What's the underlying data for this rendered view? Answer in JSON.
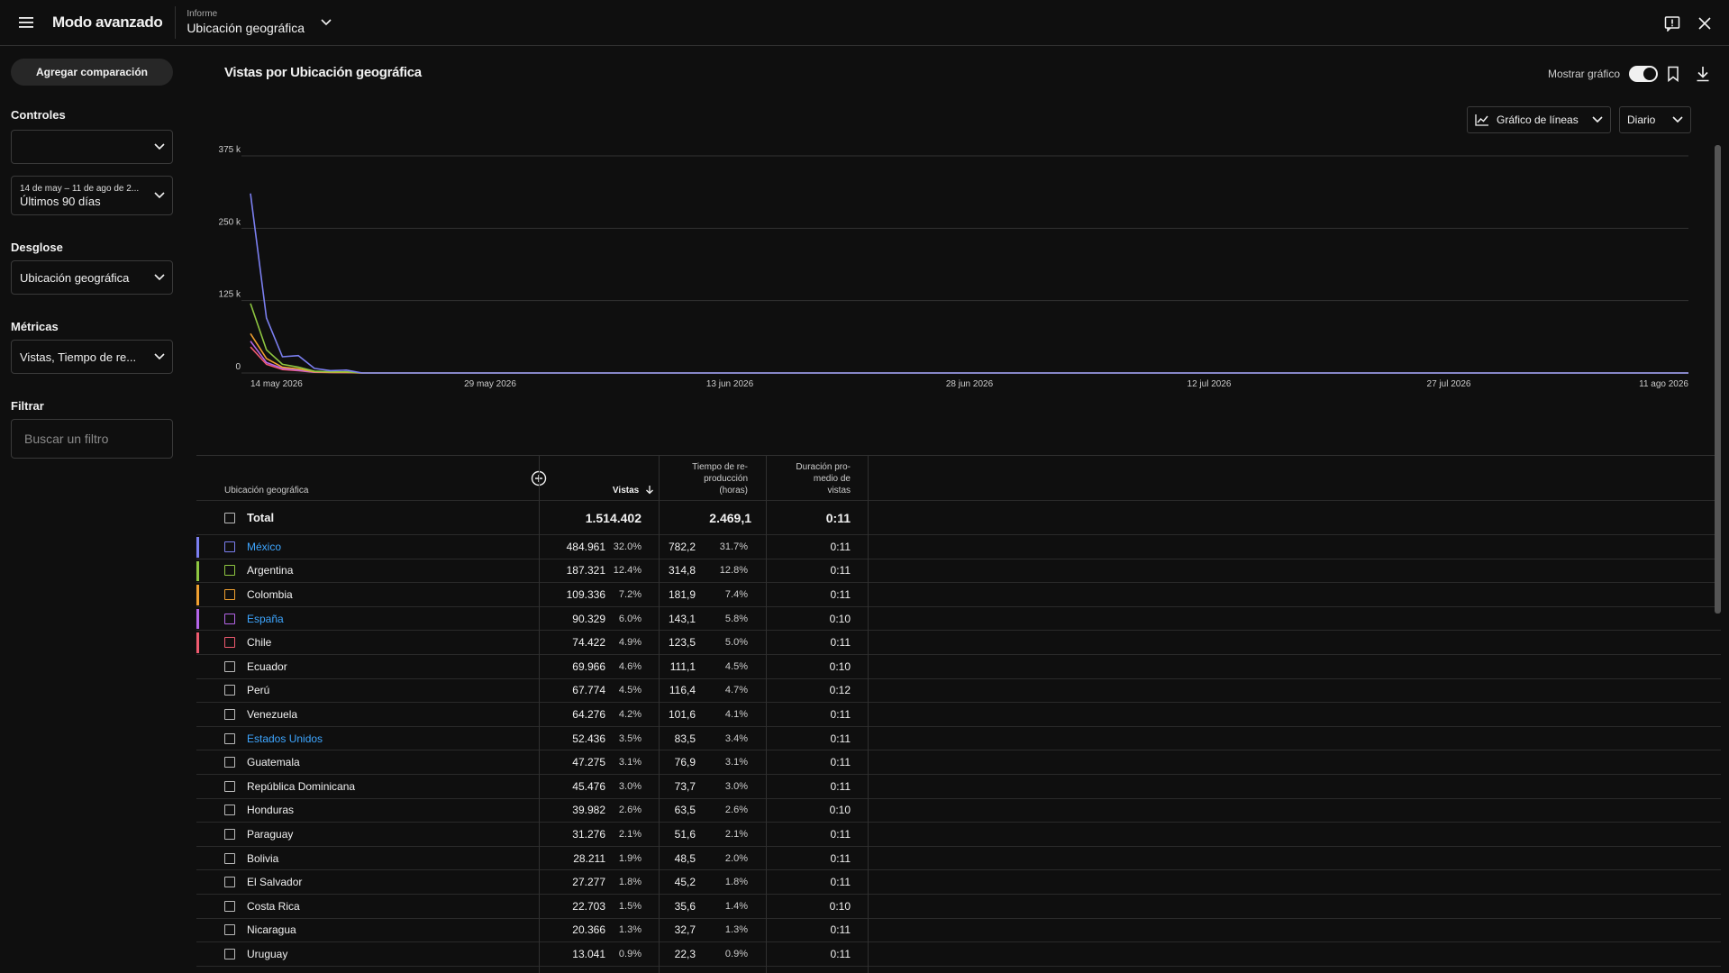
{
  "header": {
    "app_title": "Modo avanzado",
    "report_label": "Informe",
    "report_value": "Ubicación geográfica"
  },
  "sidebar": {
    "add_comparison": "Agregar comparación",
    "controls_label": "Controles",
    "controls_value": "",
    "date_range_sub": "14 de may – 11 de ago de 2...",
    "date_range_value": "Últimos 90 días",
    "breakdown_label": "Desglose",
    "breakdown_value": "Ubicación geográfica",
    "metrics_label": "Métricas",
    "metrics_value": "Vistas, Tiempo de re...",
    "filter_label": "Filtrar",
    "filter_placeholder": "Buscar un filtro"
  },
  "main": {
    "chart_title": "Vistas por Ubicación geográfica",
    "show_chart_label": "Mostrar gráfico",
    "chart_type": "Gráfico de líneas",
    "granularity": "Diario"
  },
  "chart_data": {
    "type": "line",
    "x_labels": [
      "14 may 2026",
      "29 may 2026",
      "13 jun 2026",
      "28 jun 2026",
      "12 jul 2026",
      "27 jul 2026",
      "11 ago 2026"
    ],
    "y_ticks": [
      "0",
      "125 k",
      "250 k",
      "375 k"
    ],
    "ylim": [
      0,
      375000
    ],
    "x_days": 90,
    "series": [
      {
        "name": "México",
        "color": "#7b7ff0",
        "values": [
          310000,
          95000,
          28000,
          30000,
          8000,
          4000,
          5000,
          0
        ]
      },
      {
        "name": "Argentina",
        "color": "#8ec641",
        "values": [
          120000,
          40000,
          15000,
          10000,
          3000,
          2000,
          2000,
          0
        ]
      },
      {
        "name": "Colombia",
        "color": "#f0a030",
        "values": [
          68000,
          25000,
          10000,
          7000,
          2000,
          1000,
          1000,
          0
        ]
      },
      {
        "name": "España",
        "color": "#b565e8",
        "values": [
          55000,
          18000,
          8000,
          5000,
          1500,
          1000,
          800,
          0
        ]
      },
      {
        "name": "Chile",
        "color": "#ef5a6f",
        "values": [
          45000,
          15000,
          6000,
          4000,
          1200,
          800,
          600,
          0
        ]
      }
    ]
  },
  "table": {
    "columns": {
      "location": "Ubicación geográfica",
      "views": "Vistas",
      "watch_time": [
        "Tiempo de re-",
        "producción",
        "(horas)"
      ],
      "avg_duration": [
        "Duración pro-",
        "medio de",
        "vistas"
      ]
    },
    "total": {
      "label": "Total",
      "views": "1.514.402",
      "watch": "2.469,1",
      "avg": "0:11"
    },
    "rows": [
      {
        "name": "México",
        "link": true,
        "color": "#7b7ff0",
        "views": "484.961",
        "vp": "32.0%",
        "watch": "782,2",
        "wp": "31.7%",
        "avg": "0:11"
      },
      {
        "name": "Argentina",
        "link": false,
        "color": "#8ec641",
        "views": "187.321",
        "vp": "12.4%",
        "watch": "314,8",
        "wp": "12.8%",
        "avg": "0:11"
      },
      {
        "name": "Colombia",
        "link": false,
        "color": "#f0a030",
        "views": "109.336",
        "vp": "7.2%",
        "watch": "181,9",
        "wp": "7.4%",
        "avg": "0:11"
      },
      {
        "name": "España",
        "link": true,
        "color": "#b565e8",
        "views": "90.329",
        "vp": "6.0%",
        "watch": "143,1",
        "wp": "5.8%",
        "avg": "0:10"
      },
      {
        "name": "Chile",
        "link": false,
        "color": "#ef5a6f",
        "views": "74.422",
        "vp": "4.9%",
        "watch": "123,5",
        "wp": "5.0%",
        "avg": "0:11"
      },
      {
        "name": "Ecuador",
        "link": false,
        "color": "",
        "views": "69.966",
        "vp": "4.6%",
        "watch": "111,1",
        "wp": "4.5%",
        "avg": "0:10"
      },
      {
        "name": "Perú",
        "link": false,
        "color": "",
        "views": "67.774",
        "vp": "4.5%",
        "watch": "116,4",
        "wp": "4.7%",
        "avg": "0:12"
      },
      {
        "name": "Venezuela",
        "link": false,
        "color": "",
        "views": "64.276",
        "vp": "4.2%",
        "watch": "101,6",
        "wp": "4.1%",
        "avg": "0:11"
      },
      {
        "name": "Estados Unidos",
        "link": true,
        "color": "",
        "views": "52.436",
        "vp": "3.5%",
        "watch": "83,5",
        "wp": "3.4%",
        "avg": "0:11"
      },
      {
        "name": "Guatemala",
        "link": false,
        "color": "",
        "views": "47.275",
        "vp": "3.1%",
        "watch": "76,9",
        "wp": "3.1%",
        "avg": "0:11"
      },
      {
        "name": "República Dominicana",
        "link": false,
        "color": "",
        "views": "45.476",
        "vp": "3.0%",
        "watch": "73,7",
        "wp": "3.0%",
        "avg": "0:11"
      },
      {
        "name": "Honduras",
        "link": false,
        "color": "",
        "views": "39.982",
        "vp": "2.6%",
        "watch": "63,5",
        "wp": "2.6%",
        "avg": "0:10"
      },
      {
        "name": "Paraguay",
        "link": false,
        "color": "",
        "views": "31.276",
        "vp": "2.1%",
        "watch": "51,6",
        "wp": "2.1%",
        "avg": "0:11"
      },
      {
        "name": "Bolivia",
        "link": false,
        "color": "",
        "views": "28.211",
        "vp": "1.9%",
        "watch": "48,5",
        "wp": "2.0%",
        "avg": "0:11"
      },
      {
        "name": "El Salvador",
        "link": false,
        "color": "",
        "views": "27.277",
        "vp": "1.8%",
        "watch": "45,2",
        "wp": "1.8%",
        "avg": "0:11"
      },
      {
        "name": "Costa Rica",
        "link": false,
        "color": "",
        "views": "22.703",
        "vp": "1.5%",
        "watch": "35,6",
        "wp": "1.4%",
        "avg": "0:10"
      },
      {
        "name": "Nicaragua",
        "link": false,
        "color": "",
        "views": "20.366",
        "vp": "1.3%",
        "watch": "32,7",
        "wp": "1.3%",
        "avg": "0:11"
      },
      {
        "name": "Uruguay",
        "link": false,
        "color": "",
        "views": "13.041",
        "vp": "0.9%",
        "watch": "22,3",
        "wp": "0.9%",
        "avg": "0:11"
      }
    ]
  }
}
